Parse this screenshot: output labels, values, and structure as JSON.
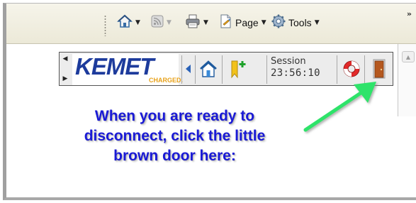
{
  "toolbar": {
    "page_label": "Page",
    "tools_label": "Tools",
    "overflow": "»"
  },
  "kemet": {
    "logo_text": "KEMET",
    "logo_sub": "CHARGED.",
    "session_label": "Session",
    "session_time": "23:56:10"
  },
  "instruction": {
    "lines": [
      "When you are ready to",
      "disconnect, click the little",
      "brown door here:"
    ]
  },
  "colors": {
    "instruction_text": "#1a1ad6",
    "arrow": "#2ee36a",
    "door": "#b5581f",
    "logo_blue": "#1d3b9c",
    "logo_orange": "#e8a21a"
  }
}
